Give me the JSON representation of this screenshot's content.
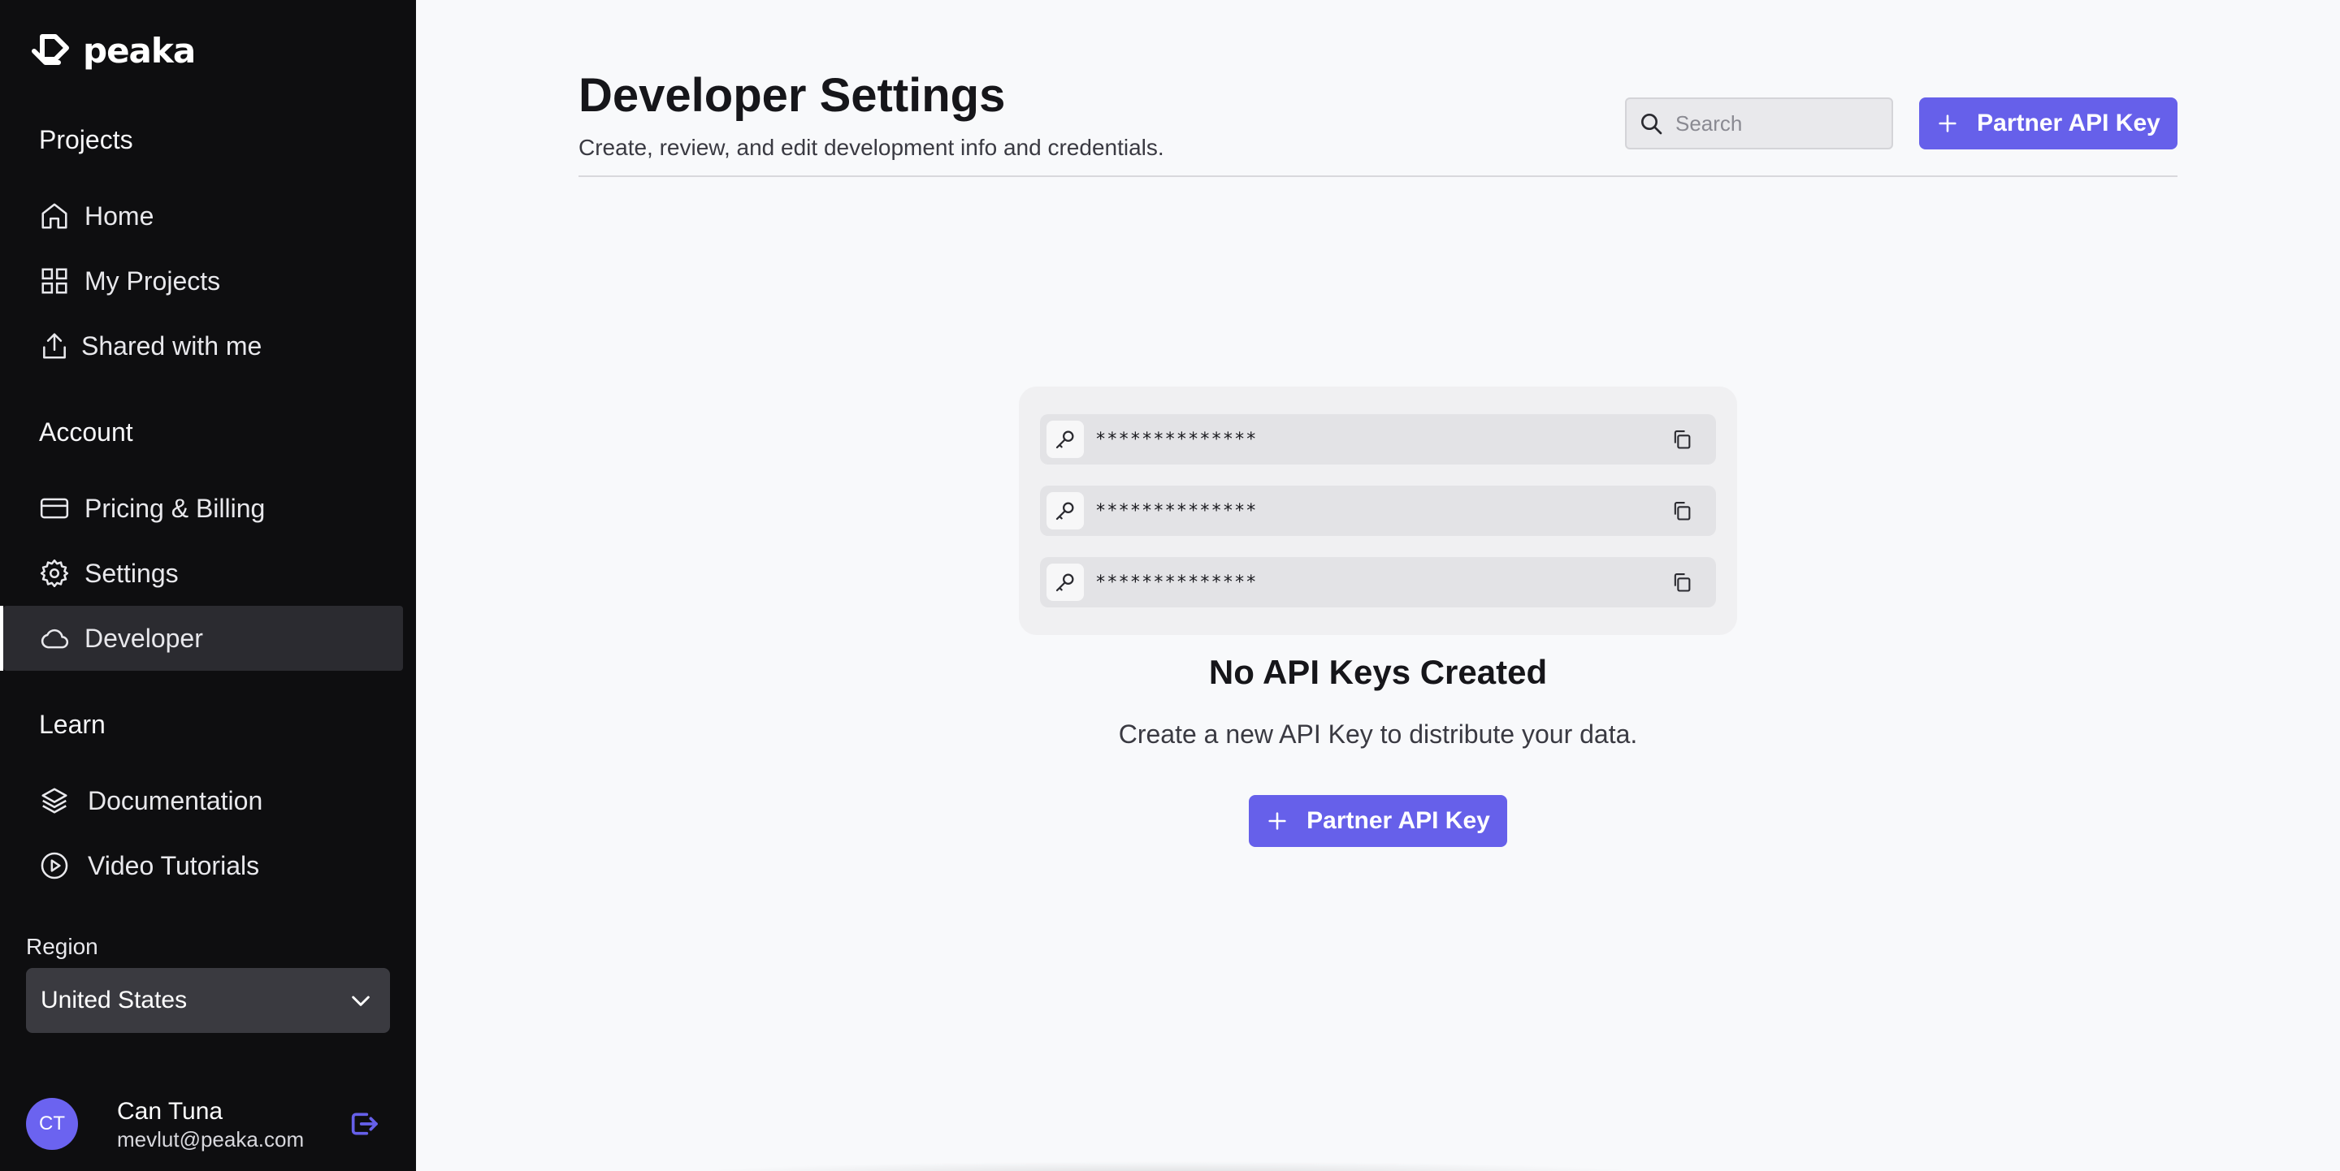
{
  "brand": {
    "name": "peaka"
  },
  "sidebar": {
    "sections": [
      {
        "title": "Projects",
        "items": [
          {
            "label": "Home",
            "icon": "home-icon"
          },
          {
            "label": "My Projects",
            "icon": "grid-icon"
          },
          {
            "label": "Shared with me",
            "icon": "share-icon"
          }
        ]
      },
      {
        "title": "Account",
        "items": [
          {
            "label": "Pricing & Billing",
            "icon": "credit-card-icon"
          },
          {
            "label": "Settings",
            "icon": "gear-icon"
          },
          {
            "label": "Developer",
            "icon": "cloud-icon",
            "active": true
          }
        ]
      },
      {
        "title": "Learn",
        "items": [
          {
            "label": "Documentation",
            "icon": "layers-icon"
          },
          {
            "label": "Video Tutorials",
            "icon": "play-circle-icon"
          }
        ]
      }
    ],
    "region": {
      "label": "Region",
      "value": "United States"
    },
    "user": {
      "initials": "CT",
      "name": "Can Tuna",
      "email": "mevlut@peaka.com"
    }
  },
  "header": {
    "title": "Developer Settings",
    "subtitle": "Create, review, and edit development info and credentials.",
    "search_placeholder": "Search",
    "primary_button": "Partner API Key"
  },
  "empty_state": {
    "keys": [
      "**************",
      "**************",
      "**************"
    ],
    "title": "No API Keys Created",
    "description": "Create a new API Key to distribute your data.",
    "button": "Partner API Key"
  },
  "colors": {
    "sidebar_bg": "#0e0e10",
    "accent": "#6660ea",
    "page_bg": "#f8f9fb",
    "active_item_bg": "#2b2b30"
  }
}
